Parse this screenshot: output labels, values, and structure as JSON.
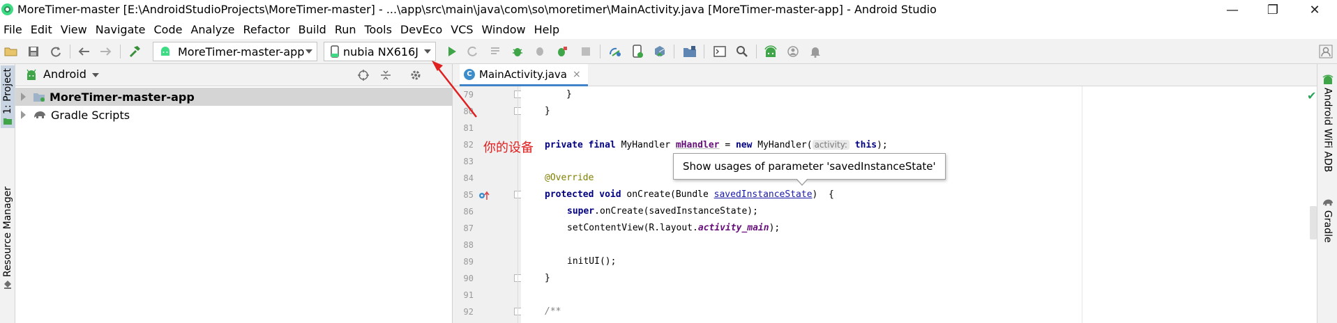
{
  "window": {
    "title": "MoreTimer-master [E:\\AndroidStudioProjects\\MoreTimer-master] - ...\\app\\src\\main\\java\\com\\so\\moretimer\\MainActivity.java [MoreTimer-master-app] - Android Studio",
    "minimize": "—",
    "maximize": "❐",
    "close": "✕"
  },
  "menu": [
    "File",
    "Edit",
    "View",
    "Navigate",
    "Code",
    "Analyze",
    "Refactor",
    "Build",
    "Run",
    "Tools",
    "DevEco",
    "VCS",
    "Window",
    "Help"
  ],
  "toolbar": {
    "run_config": "MoreTimer-master-app",
    "device": "nubia NX616J"
  },
  "left_strip": {
    "project_tab": "1: Project",
    "resource_manager_tab": "Resource Manager"
  },
  "project_panel": {
    "view_mode": "Android",
    "tree": [
      {
        "label": "MoreTimer-master-app",
        "selected": true
      },
      {
        "label": "Gradle Scripts",
        "selected": false
      }
    ]
  },
  "editor": {
    "tab_label": "MainActivity.java",
    "tab_icon": "C",
    "tab_close": "×",
    "line_numbers": [
      "79",
      "80",
      "81",
      "82",
      "83",
      "84",
      "85",
      "86",
      "87",
      "88",
      "89",
      "90",
      "91",
      "92"
    ],
    "code": {
      "l79": "}",
      "l80": "}",
      "l82_kw": "private final",
      "l82_type": "MyHandler",
      "l82_field": "mHandler",
      "l82_eq": "=",
      "l82_new": "new",
      "l82_ctor": "MyHandler(",
      "l82_hint": "activity:",
      "l82_this": "this",
      "l82_end": ");",
      "l84": "@Override",
      "l85_kw": "protected void",
      "l85_sig": "onCreate(Bundle",
      "l85_param": "savedInstanceState",
      "l85_end": ")  {",
      "l86_super": "super",
      "l86_rest": ".onCreate(savedInstanceState);",
      "l87_a": "setContentView(R.layout.",
      "l87_field": "activity_main",
      "l87_end": ");",
      "l89": "initUI();",
      "l90": "}",
      "l92": "/**"
    },
    "tooltip": "Show usages of parameter 'savedInstanceState'"
  },
  "annotation": {
    "text": "你的设备",
    "color": "#e02020"
  },
  "right_strip": {
    "wifi_adb_tab": "Android WiFi ADB",
    "gradle_tab": "Gradle"
  },
  "colors": {
    "keyword": "#000080",
    "annotation": "#808000",
    "field": "#660e7a",
    "tab_underline": "#4083c9",
    "android_green": "#3ddc84"
  }
}
